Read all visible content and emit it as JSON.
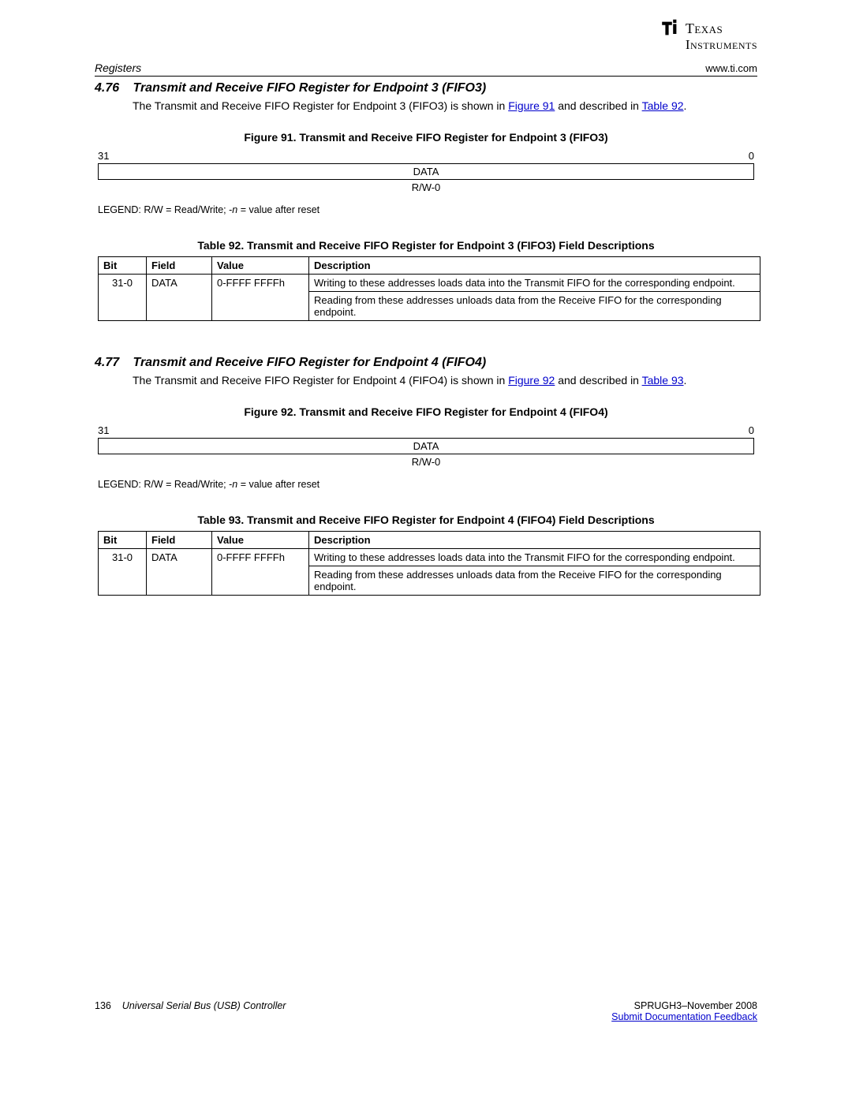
{
  "logo": {
    "line1": "Texas",
    "line2": "Instruments"
  },
  "header": {
    "left": "Registers",
    "right": "www.ti.com"
  },
  "sections": [
    {
      "number": "4.76",
      "title": "Transmit and Receive FIFO Register for Endpoint 3 (FIFO3)",
      "intro_pre": "The Transmit and Receive FIFO Register for Endpoint 3 (FIFO3) is shown in ",
      "fig_link": "Figure 91",
      "intro_mid": " and described in ",
      "tbl_link": "Table 92",
      "intro_post": ".",
      "figure_caption": "Figure 91. Transmit and Receive FIFO Register for Endpoint 3 (FIFO3)",
      "bit_high": "31",
      "bit_low": "0",
      "reg_name": "DATA",
      "rw": "R/W-0",
      "legend_label": "LEGEND: R/W = Read/Write; -",
      "legend_n": "n",
      "legend_post": " = value after reset",
      "table_caption": "Table 92. Transmit and Receive FIFO Register for Endpoint 3 (FIFO3) Field Descriptions",
      "headers": {
        "bit": "Bit",
        "field": "Field",
        "value": "Value",
        "desc": "Description"
      },
      "row": {
        "bit": "31-0",
        "field": "DATA",
        "value": "0-FFFF FFFFh",
        "desc1": "Writing to these addresses loads data into the Transmit FIFO for the corresponding endpoint.",
        "desc2": "Reading from these addresses unloads data from the Receive FIFO for the corresponding endpoint."
      }
    },
    {
      "number": "4.77",
      "title": "Transmit and Receive FIFO Register for Endpoint 4 (FIFO4)",
      "intro_pre": "The Transmit and Receive FIFO Register for Endpoint 4 (FIFO4) is shown in ",
      "fig_link": "Figure 92",
      "intro_mid": " and described in ",
      "tbl_link": "Table 93",
      "intro_post": ".",
      "figure_caption": "Figure 92. Transmit and Receive FIFO Register for Endpoint 4 (FIFO4)",
      "bit_high": "31",
      "bit_low": "0",
      "reg_name": "DATA",
      "rw": "R/W-0",
      "legend_label": "LEGEND: R/W = Read/Write; -",
      "legend_n": "n",
      "legend_post": " = value after reset",
      "table_caption": "Table 93. Transmit and Receive FIFO Register for Endpoint 4 (FIFO4) Field Descriptions",
      "headers": {
        "bit": "Bit",
        "field": "Field",
        "value": "Value",
        "desc": "Description"
      },
      "row": {
        "bit": "31-0",
        "field": "DATA",
        "value": "0-FFFF FFFFh",
        "desc1": "Writing to these addresses loads data into the Transmit FIFO for the corresponding endpoint.",
        "desc2": "Reading from these addresses unloads data from the Receive FIFO for the corresponding endpoint."
      }
    }
  ],
  "footer": {
    "page_num": "136",
    "doc_title": "Universal Serial Bus (USB) Controller",
    "doc_id": "SPRUGH3–November 2008",
    "feedback": "Submit Documentation Feedback"
  }
}
